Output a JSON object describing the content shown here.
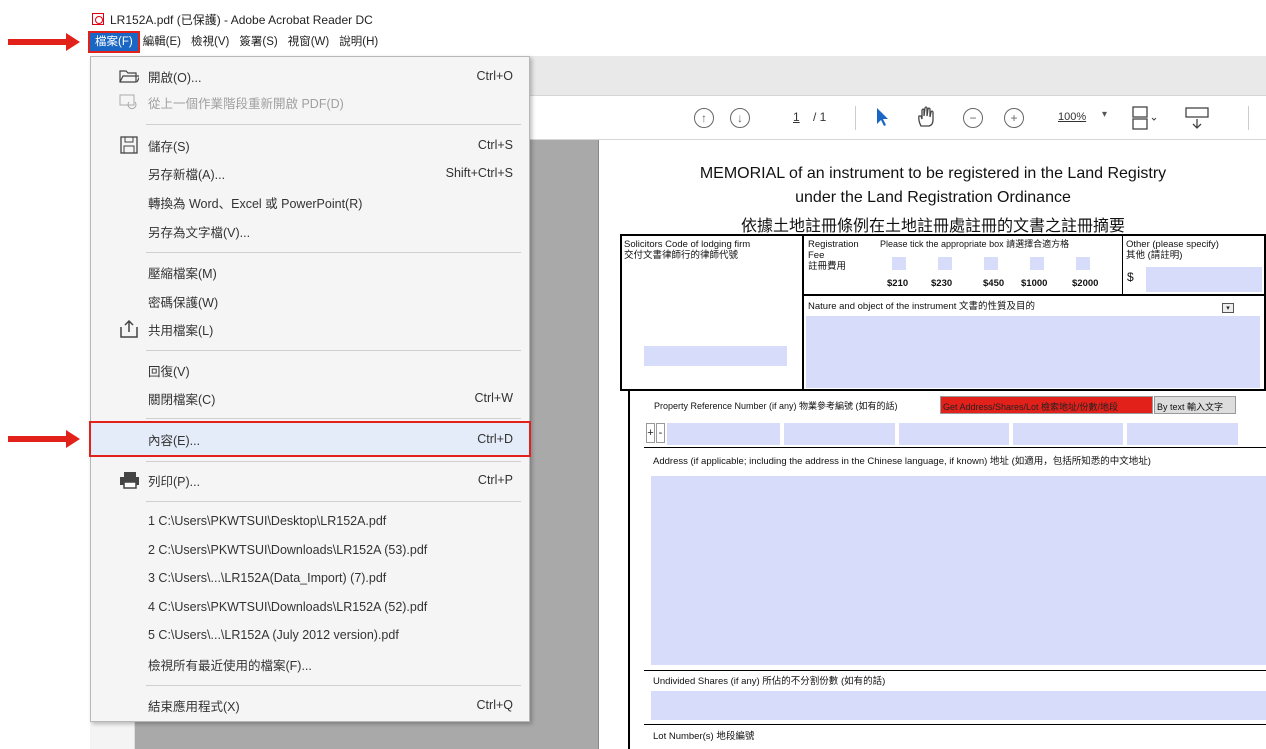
{
  "window": {
    "title": "LR152A.pdf (已保護) - Adobe Acrobat Reader DC"
  },
  "menubar": [
    "檔案(F)",
    "編輯(E)",
    "檢視(V)",
    "簽署(S)",
    "視窗(W)",
    "說明(H)"
  ],
  "toolbar": {
    "page_current": "1",
    "page_total": "/ 1",
    "zoom": "100%"
  },
  "menu": {
    "open": {
      "label": "開啟(O)...",
      "shortcut": "Ctrl+O"
    },
    "reopen": {
      "label": "從上一個作業階段重新開啟 PDF(D)"
    },
    "save": {
      "label": "儲存(S)",
      "shortcut": "Ctrl+S"
    },
    "save_as": {
      "label": "另存新檔(A)...",
      "shortcut": "Shift+Ctrl+S"
    },
    "convert": {
      "label": "轉換為 Word、Excel 或 PowerPoint(R)"
    },
    "save_text": {
      "label": "另存為文字檔(V)..."
    },
    "compress": {
      "label": "壓縮檔案(M)"
    },
    "password": {
      "label": "密碼保護(W)"
    },
    "share": {
      "label": "共用檔案(L)"
    },
    "revert": {
      "label": "回復(V)"
    },
    "close": {
      "label": "關閉檔案(C)",
      "shortcut": "Ctrl+W"
    },
    "properties": {
      "label": "內容(E)...",
      "shortcut": "Ctrl+D"
    },
    "print": {
      "label": "列印(P)...",
      "shortcut": "Ctrl+P"
    },
    "recent": [
      "1 C:\\Users\\PKWTSUI\\Desktop\\LR152A.pdf",
      "2 C:\\Users\\PKWTSUI\\Downloads\\LR152A (53).pdf",
      "3 C:\\Users\\...\\LR152A(Data_Import) (7).pdf",
      "4 C:\\Users\\PKWTSUI\\Downloads\\LR152A (52).pdf",
      "5 C:\\Users\\...\\LR152A (July 2012 version).pdf"
    ],
    "view_recent": {
      "label": "檢視所有最近使用的檔案(F)..."
    },
    "exit": {
      "label": "結束應用程式(X)",
      "shortcut": "Ctrl+Q"
    }
  },
  "document": {
    "title1": "MEMORIAL of an instrument to be registered in the Land Registry",
    "title2": "under the Land Registration Ordinance",
    "title3": "依據土地註冊條例在土地註冊處註冊的文書之註冊摘要",
    "solicitors": "Solicitors Code of lodging firm",
    "solicitors_zh": "交付文書律師行的律師代號",
    "reg_fee": "Registration Fee",
    "reg_fee_zh": "註冊費用",
    "tick": "Please tick the appropriate box 請選擇合適方格",
    "fees": [
      "$210",
      "$230",
      "$450",
      "$1000",
      "$2000"
    ],
    "other": "Other (please specify)",
    "other_zh": "其他 (請註明)",
    "dollar": "$",
    "nature": "Nature and object of the instrument 文書的性質及目的",
    "prn": "Property Reference Number (if any) 物業參考編號 (如有的話)",
    "get_address": "Get Address/Shares/Lot 檢索地址/份數/地段",
    "by_text": "By text 輸入文字",
    "address": "Address (if applicable; including the address in the Chinese language, if known) 地址 (如適用，包括所知悉的中文地址)",
    "undivided": "Undivided Shares (if any) 所佔的不分割份數 (如有的話)",
    "lot": "Lot Number(s) 地段編號"
  },
  "colors": {
    "accent": "#1a66c4",
    "highlight": "#e3211b",
    "field": "#d6dcf9"
  }
}
